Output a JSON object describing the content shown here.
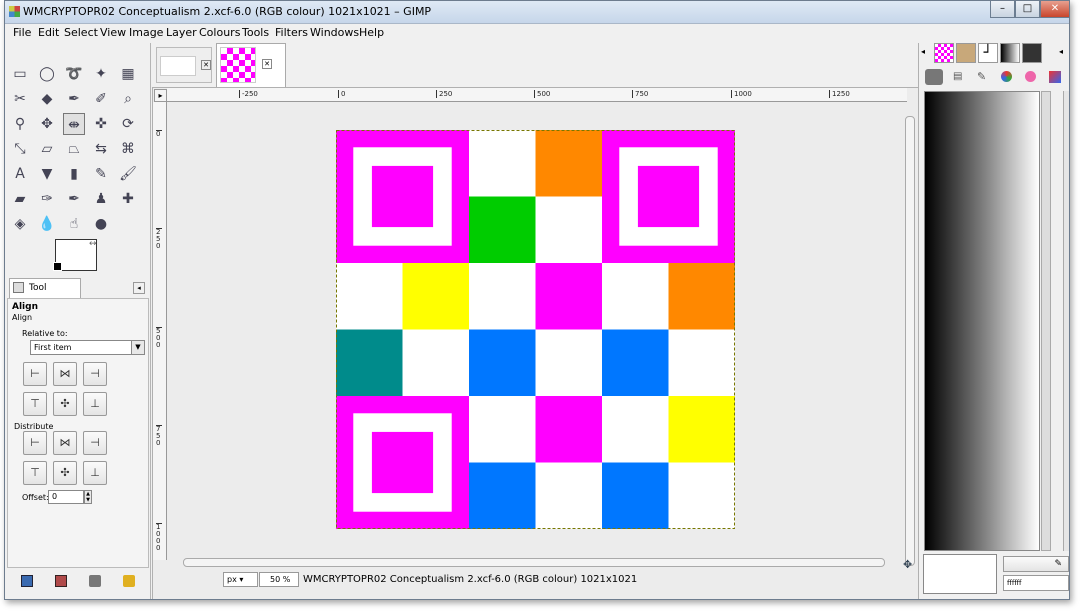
{
  "window": {
    "title": "WMCRYPTOPR02 Conceptualism 2.xcf-6.0 (RGB colour) 1021x1021 – GIMP",
    "controls": [
      "–",
      "□",
      "✕"
    ]
  },
  "menu": [
    "File",
    "Edit",
    "Select",
    "View",
    "Image",
    "Layer",
    "Colours",
    "Tools",
    "Filters",
    "Windows",
    "Help"
  ],
  "tool_options": {
    "tab_label": "Tool Options",
    "heading": "Align",
    "subheading": "Align",
    "relative_to_label": "Relative to:",
    "relative_to_value": "First item",
    "distribute_label": "Distribute",
    "offset_label": "Offset:",
    "offset_value": "0"
  },
  "ruler": {
    "h_labels": [
      "-250",
      "0",
      "250",
      "500",
      "750",
      "1000",
      "1250"
    ],
    "v_labels": [
      "0",
      "250",
      "500",
      "750",
      "1000"
    ]
  },
  "statusbar": {
    "unit": "px",
    "zoom": "50 %",
    "info": "WMCRYPTOPR02 Conceptualism 2.xcf-6.0 (RGB colour) 1021x1021"
  },
  "right_panel": {
    "color_value": "ffffff"
  },
  "artwork": {
    "grid": 6,
    "colors": {
      "M": "#ff00ff",
      "W": "#ffffff",
      "O": "#ff8800",
      "G": "#00cc00",
      "Y": "#ffff00",
      "T": "#008b8b",
      "B": "#0077ff"
    },
    "rows": [
      "MMWOMM",
      "MMGWMM",
      "WYWMWO",
      "TWBWBW",
      "MMWMWY",
      "MMBWBW"
    ]
  }
}
